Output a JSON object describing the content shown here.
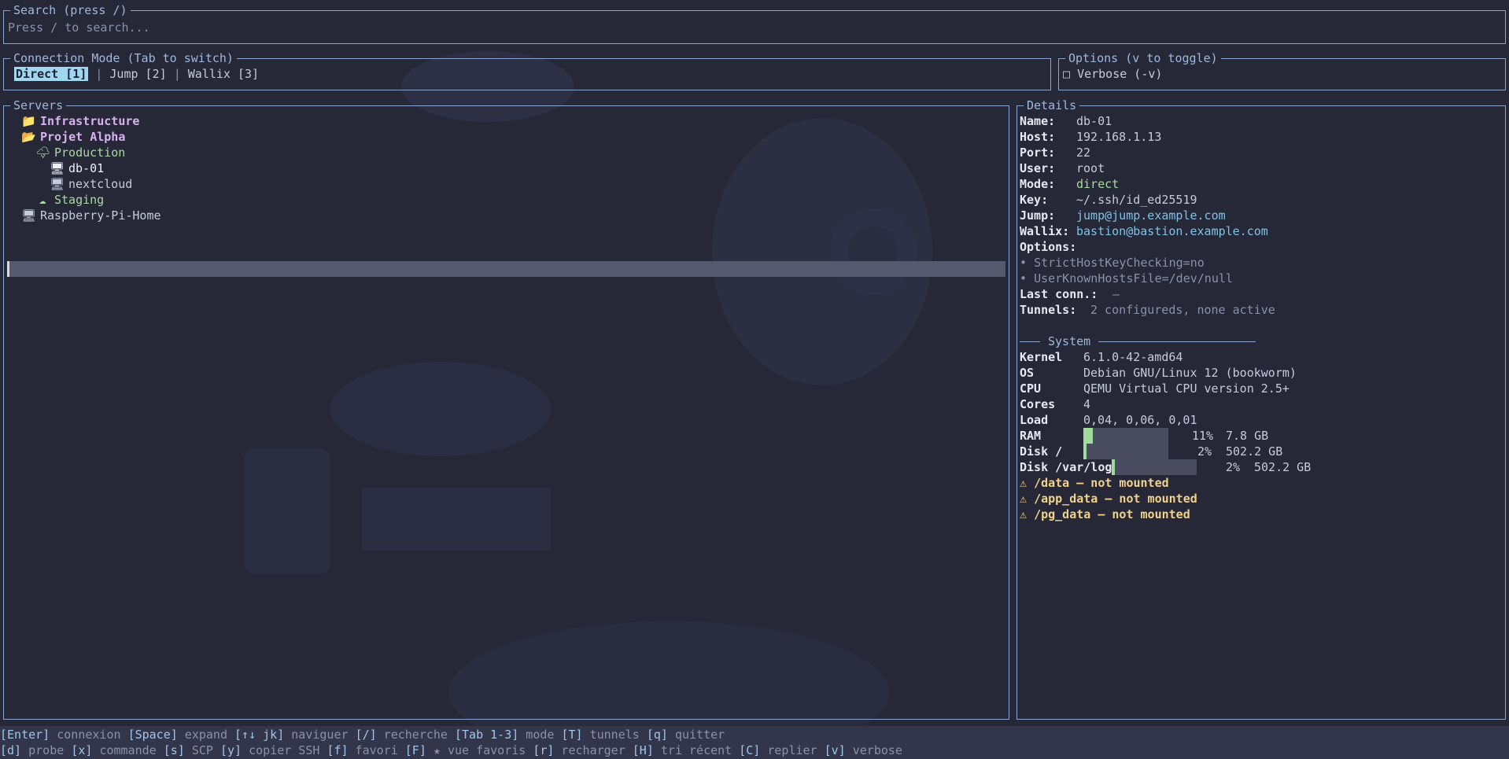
{
  "search": {
    "title": "Search (press /)",
    "placeholder": "Press / to search..."
  },
  "mode": {
    "title": "Connection Mode (Tab to switch)",
    "options": [
      "Direct [1]",
      "Jump [2]",
      "Wallix [3]"
    ],
    "separator": "|"
  },
  "options_panel": {
    "title": "Options (v to toggle)",
    "verbose": "Verbose (-v)",
    "checkbox": "□"
  },
  "servers": {
    "title": "Servers",
    "items": [
      {
        "icon": "📁",
        "label": "Infrastructure"
      },
      {
        "icon": "📂",
        "label": "Projet Alpha"
      },
      {
        "icon": "🌩",
        "label": "Production"
      },
      {
        "icon": "🖥",
        "label": "db-01"
      },
      {
        "icon": "🖥",
        "label": "nextcloud"
      },
      {
        "icon": "☁",
        "label": "Staging"
      },
      {
        "icon": "🖥",
        "label": "Raspberry-Pi-Home"
      }
    ]
  },
  "details": {
    "title": "Details",
    "rows": [
      {
        "k": "Name:",
        "v": "db-01"
      },
      {
        "k": "Host:",
        "v": "192.168.1.13"
      },
      {
        "k": "Port:",
        "v": "22"
      },
      {
        "k": "User:",
        "v": "root"
      },
      {
        "k": "Mode:",
        "v": "direct"
      },
      {
        "k": "Key:",
        "v": "~/.ssh/id_ed25519"
      },
      {
        "k": "Jump:",
        "v": "jump@jump.example.com"
      },
      {
        "k": "Wallix:",
        "v": "bastion@bastion.example.com"
      }
    ],
    "options_label": "Options:",
    "options": [
      "StrictHostKeyChecking=no",
      "UserKnownHostsFile=/dev/null"
    ],
    "bullet": "•",
    "last_conn": {
      "k": "Last conn.:",
      "v": "—"
    },
    "tunnels": {
      "k": "Tunnels:",
      "v": "2 configureds, none active"
    },
    "system_title": "System",
    "system": [
      {
        "k": "Kernel",
        "v": "6.1.0-42-amd64"
      },
      {
        "k": "OS",
        "v": "Debian GNU/Linux 12 (bookworm)"
      },
      {
        "k": "CPU",
        "v": "QEMU Virtual CPU version 2.5+"
      },
      {
        "k": "Cores",
        "v": "4"
      },
      {
        "k": "Load",
        "v": "0,04, 0,06, 0,01"
      }
    ],
    "disks": [
      {
        "k": "RAM",
        "pct_text": "11%",
        "size": "7.8 GB",
        "usage": 0.11
      },
      {
        "k": "Disk /",
        "pct_text": "2%",
        "size": "502.2 GB",
        "usage": 0.02
      },
      {
        "k": "Disk /var/log",
        "pct_text": "2%",
        "size": "502.2 GB",
        "usage": 0.02
      }
    ],
    "warn_icon": "⚠",
    "warnings": [
      "/data — not mounted",
      "/app_data — not mounted",
      "/pg_data — not mounted"
    ]
  },
  "footer": {
    "line1": [
      {
        "k": "[Enter]",
        "a": "connexion"
      },
      {
        "k": "[Space]",
        "a": "expand"
      },
      {
        "k": "[↑↓ jk]",
        "a": "naviguer"
      },
      {
        "k": "[/]",
        "a": "recherche"
      },
      {
        "k": "[Tab 1-3]",
        "a": "mode"
      },
      {
        "k": "[T]",
        "a": "tunnels"
      },
      {
        "k": "[q]",
        "a": "quitter"
      }
    ],
    "line2": [
      {
        "k": "[d]",
        "a": "probe"
      },
      {
        "k": "[x]",
        "a": "commande"
      },
      {
        "k": "[s]",
        "a": "SCP"
      },
      {
        "k": "[y]",
        "a": "copier SSH"
      },
      {
        "k": "[f]",
        "a": "favori"
      },
      {
        "k": "[F]",
        "a": "★ vue favoris"
      },
      {
        "k": "[r]",
        "a": "recharger"
      },
      {
        "k": "[H]",
        "a": "tri récent"
      },
      {
        "k": "[C]",
        "a": "replier"
      },
      {
        "k": "[v]",
        "a": "verbose"
      }
    ]
  },
  "colors": {
    "background": "#262838",
    "border": "#8aa6cf",
    "accent": "#9fd6f0",
    "folder": "#d7b2ee",
    "green": "#a9d8a0",
    "warn": "#f0d28a"
  }
}
